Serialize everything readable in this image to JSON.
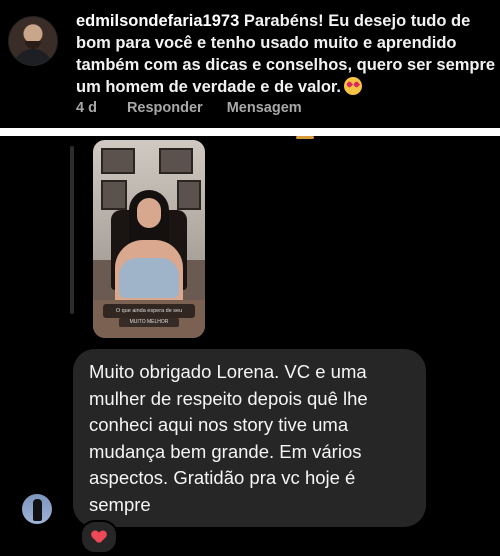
{
  "comment": {
    "username": "edmilsondefaria1973",
    "text": " Parabéns! Eu desejo tudo de bom para você e tenho usado muito e aprendido também com as dicas e conselhos, quero ser sempre um homem de verdade e de valor.",
    "emoji": "heart-eyes-emoji",
    "time": "4 d",
    "reply_label": "Responder",
    "message_label": "Mensagem"
  },
  "story": {
    "caption_line1": "O que ainda espera de seu",
    "caption_line2": "MUITO MELHOR"
  },
  "message": {
    "text": "Muito obrigado Lorena. VC e uma mulher de respeito depois quê lhe conheci aqui nos story tive uma mudança bem grande. Em vários aspectos. Gratidão pra vc hoje é sempre"
  },
  "reaction": {
    "icon": "heart-icon",
    "color": "#ed4956"
  },
  "colors": {
    "background": "#000000",
    "bubble": "#262626",
    "meta_text": "#a8a8a8"
  }
}
